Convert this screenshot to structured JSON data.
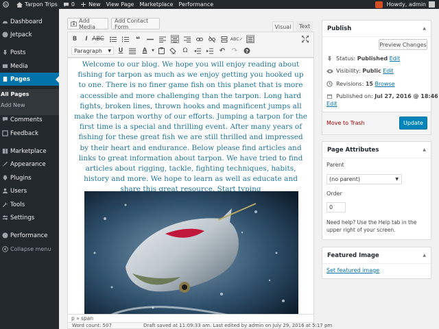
{
  "adminbar": {
    "site": "Tarpon Trips",
    "comments": "0",
    "new": "New",
    "view": "View Page",
    "marketplace": "Marketplace",
    "performance": "Performance",
    "greeting": "Howdy, admin"
  },
  "sidebar": {
    "items": [
      {
        "label": "Dashboard",
        "icon": "dashboard-icon"
      },
      {
        "label": "Jetpack",
        "icon": "jetpack-icon"
      },
      {
        "label": "Posts",
        "icon": "pin-icon"
      },
      {
        "label": "Media",
        "icon": "media-icon"
      },
      {
        "label": "Pages",
        "icon": "page-icon"
      },
      {
        "label": "Comments",
        "icon": "comment-icon"
      },
      {
        "label": "Feedback",
        "icon": "feedback-icon"
      },
      {
        "label": "Marketplace",
        "icon": "marketplace-icon"
      },
      {
        "label": "Appearance",
        "icon": "brush-icon"
      },
      {
        "label": "Plugins",
        "icon": "plugin-icon"
      },
      {
        "label": "Users",
        "icon": "users-icon"
      },
      {
        "label": "Tools",
        "icon": "wrench-icon"
      },
      {
        "label": "Settings",
        "icon": "settings-icon"
      },
      {
        "label": "Performance",
        "icon": "performance-icon"
      },
      {
        "label": "Collapse menu",
        "icon": "collapse-icon"
      }
    ],
    "sub": {
      "all_pages": "All Pages",
      "add_new": "Add New"
    }
  },
  "editor": {
    "add_media": "Add Media",
    "add_contact_form": "Add Contact Form",
    "tab_visual": "Visual",
    "tab_text": "Text",
    "format": "Paragraph",
    "body": "Welcome to our blog. We hope you will enjoy reading about fishing for tarpon as much as we enjoy getting you hooked up to one. There is no finer game fish on this planet that is more accessible and more challenging than the tarpon. Long hard fights, broken lines, thrown hooks and magnificent jumps all make the tarpon worthy of our efforts. Jumping a tarpon for the first time is a special and thrilling event. After many years of fishing for these great fish we are still thrilled and impressed by their heart and endurance. Below please find articles and links to great information about tarpon. We have tried to find articles about rigging, tackle, fighting techniques, habits, history and more. We hope to learn as well as educate and share this great resource. Start typing",
    "path": "p » span",
    "word_count": "Word count: 507",
    "draft_saved": "Draft saved at 11:09:33 am. Last edited by admin on July 29, 2016 at 5:17 pm"
  },
  "publish": {
    "title": "Publish",
    "preview": "Preview Changes",
    "status_label": "Status:",
    "status_value": "Published",
    "visibility_label": "Visibility:",
    "visibility_value": "Public",
    "revisions_label": "Revisions:",
    "revisions_value": "15",
    "browse": "Browse",
    "published_label": "Published on:",
    "published_value": "Jul 27, 2016 @ 18:46",
    "edit": "Edit",
    "trash": "Move to Trash",
    "update": "Update"
  },
  "attributes": {
    "title": "Page Attributes",
    "parent_label": "Parent",
    "parent_value": "(no parent)",
    "order_label": "Order",
    "order_value": "0",
    "help": "Need help? Use the Help tab in the upper right of your screen."
  },
  "featured": {
    "title": "Featured Image",
    "set": "Set featured image"
  },
  "colors": {
    "accent": "#0073aa",
    "sidebar": "#23282d",
    "adminbar": "#23282d",
    "link": "#21759b"
  }
}
